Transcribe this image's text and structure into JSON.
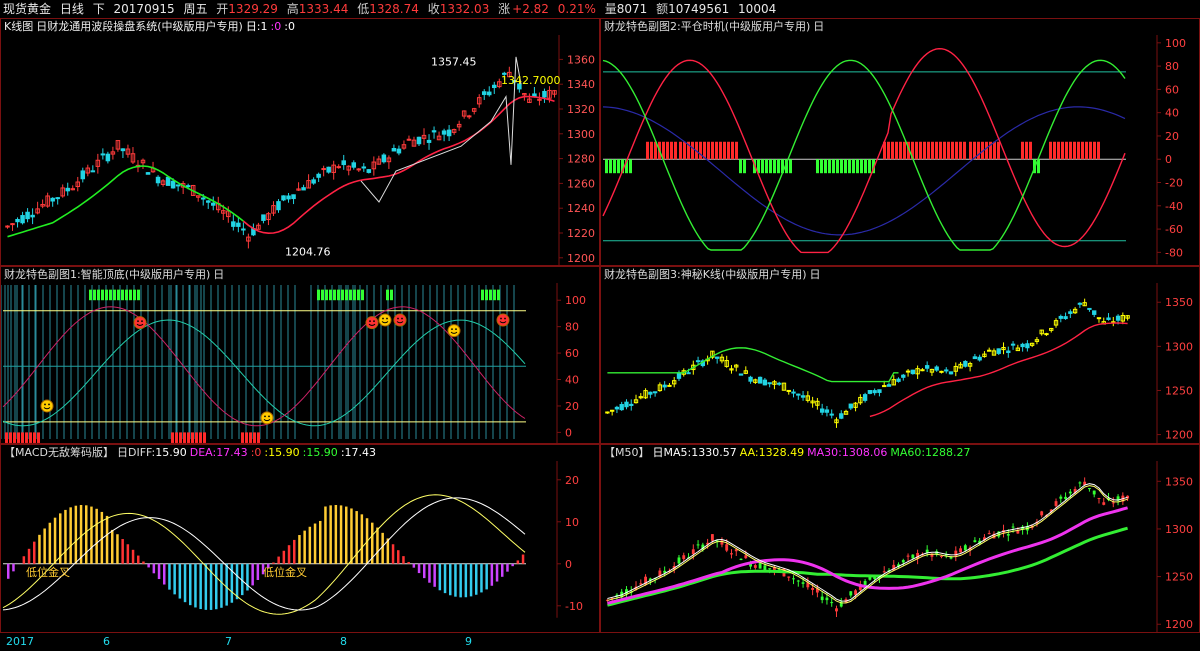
{
  "header": {
    "symbol": "现货黄金",
    "period": "日线",
    "right_mode": "下",
    "date": "20170915",
    "weekday": "周五",
    "open_label": "开",
    "open": "1329.29",
    "high_label": "高",
    "high": "1333.44",
    "low_label": "低",
    "low": "1328.74",
    "close_label": "收",
    "close": "1332.03",
    "change_label": "涨",
    "change": "+2.82",
    "change_pct": "0.21%",
    "vol_label": "量",
    "vol": "8071",
    "amt_label": "额",
    "amt": "10749561",
    "extra": "10004"
  },
  "panels": {
    "kline": {
      "title": "K线图",
      "sub": "日财龙通用波段操盘系统(中级版用户专用)",
      "p1": "日:1",
      "p2": ":0",
      "p3": ":0",
      "y_ticks": [
        "1360",
        "1340",
        "1320",
        "1300",
        "1280",
        "1260",
        "1240",
        "1220",
        "1200"
      ],
      "annot_high": "1357.45",
      "annot_low": "1204.76",
      "annot_price": "1342.7000"
    },
    "sub2": {
      "title": "财龙特色副图2:平仓时机(中级版用户专用)",
      "icon": "日",
      "y_ticks": [
        "100",
        "80",
        "60",
        "40",
        "20",
        "0",
        "-20",
        "-40",
        "-60",
        "-80"
      ]
    },
    "sub1": {
      "title": "财龙特色副图1:智能顶底(中级版用户专用)",
      "icon": "日",
      "y_ticks": [
        "100",
        "80",
        "60",
        "40",
        "20",
        "0"
      ]
    },
    "sub3": {
      "title": "财龙特色副图3:神秘K线(中级版用户专用)",
      "icon": "日",
      "y_ticks": [
        "1350",
        "1300",
        "1250",
        "1200"
      ]
    },
    "macd": {
      "title": "【MACD无敌筹码版】",
      "diff_label": "日DIFF:",
      "diff": "15.90",
      "dea_label": "DEA:",
      "dea": "17.43",
      "v1": ":0",
      "v2": ":15.90",
      "v3": ":15.90",
      "v4": ":17.43",
      "y_ticks": [
        "20",
        "10",
        "0",
        "-10"
      ],
      "note1": "低位金叉",
      "note2": "低位金叉"
    },
    "ma": {
      "title": "【M50】",
      "ma5_label": "日MA5:",
      "ma5": "1330.57",
      "aa_label": "AA:",
      "aa": "1328.49",
      "ma30_label": "MA30:",
      "ma30": "1308.06",
      "ma60_label": "MA60:",
      "ma60": "1288.27",
      "y_ticks": [
        "1350",
        "1300",
        "1250",
        "1200"
      ]
    }
  },
  "xaxis": {
    "labels": [
      "2017",
      "6",
      "7",
      "8",
      "9"
    ]
  },
  "colors": {
    "up": "#ff3b3b",
    "down": "#22d4e4",
    "frame": "#7a1010",
    "yellow": "#ffff00",
    "green": "#33ff33",
    "magenta": "#ff33ff"
  }
}
